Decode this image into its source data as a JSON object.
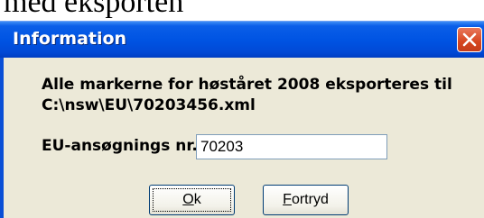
{
  "background": {
    "text": "med eksporten"
  },
  "dialog": {
    "title": "Information",
    "message_line1": "Alle markerne for høståret 2008 eksporteres til",
    "message_line2": "C:\\nsw\\EU\\70203456.xml",
    "field_label": "EU-ansøgnings nr.",
    "field_value": "70203",
    "ok_label_mnemonic": "O",
    "ok_label_rest": "k",
    "cancel_label_mnemonic": "F",
    "cancel_label_rest": "ortryd"
  },
  "colors": {
    "titlebar": "#0054e3",
    "dialog_bg": "#ece9d8",
    "close_button": "#d6451f"
  }
}
